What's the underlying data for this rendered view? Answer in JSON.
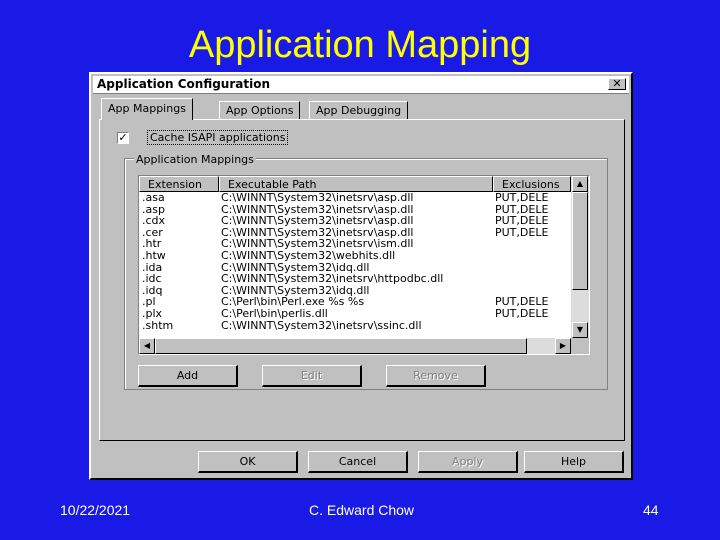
{
  "slide": {
    "title": "Application Mapping",
    "footer_date": "10/22/2021",
    "footer_author": "C. Edward Chow",
    "footer_page": "44"
  },
  "colors": {
    "background": "#1a1ae6",
    "title": "#ffff00",
    "dialog": "#c0c0c0"
  },
  "dialog": {
    "title": "Application Configuration",
    "close_glyph": "✕",
    "tabs": [
      {
        "label": "App Mappings",
        "active": true
      },
      {
        "label": "App Options",
        "active": false
      },
      {
        "label": "App Debugging",
        "active": false
      }
    ],
    "cache_checkbox": {
      "label": "Cache ISAPI applications",
      "checked": true,
      "glyph": "✓"
    },
    "group_label": "Application Mappings",
    "columns": [
      "Extension",
      "Executable Path",
      "Exclusions"
    ],
    "rows": [
      {
        "ext": ".asa",
        "path": "C:\\WINNT\\System32\\inetsrv\\asp.dll",
        "excl": "PUT,DELE"
      },
      {
        "ext": ".asp",
        "path": "C:\\WINNT\\System32\\inetsrv\\asp.dll",
        "excl": "PUT,DELE"
      },
      {
        "ext": ".cdx",
        "path": "C:\\WINNT\\System32\\inetsrv\\asp.dll",
        "excl": "PUT,DELE"
      },
      {
        "ext": ".cer",
        "path": "C:\\WINNT\\System32\\inetsrv\\asp.dll",
        "excl": "PUT,DELE"
      },
      {
        "ext": ".htr",
        "path": "C:\\WINNT\\System32\\inetsrv\\ism.dll",
        "excl": ""
      },
      {
        "ext": ".htw",
        "path": "C:\\WINNT\\System32\\webhits.dll",
        "excl": ""
      },
      {
        "ext": ".ida",
        "path": "C:\\WINNT\\System32\\idq.dll",
        "excl": ""
      },
      {
        "ext": ".idc",
        "path": "C:\\WINNT\\System32\\inetsrv\\httpodbc.dll",
        "excl": ""
      },
      {
        "ext": ".idq",
        "path": "C:\\WINNT\\System32\\idq.dll",
        "excl": ""
      },
      {
        "ext": ".pl",
        "path": "C:\\Perl\\bin\\Perl.exe %s %s",
        "excl": "PUT,DELE"
      },
      {
        "ext": ".plx",
        "path": "C:\\Perl\\bin\\perlis.dll",
        "excl": "PUT,DELE"
      },
      {
        "ext": ".shtm",
        "path": "C:\\WINNT\\System32\\inetsrv\\ssinc.dll",
        "excl": ""
      }
    ],
    "scroll": {
      "up_glyph": "▲",
      "down_glyph": "▼",
      "left_glyph": "◀",
      "right_glyph": "▶"
    },
    "list_buttons": [
      {
        "label": "Add",
        "enabled": true
      },
      {
        "label": "Edit",
        "enabled": false
      },
      {
        "label": "Remove",
        "enabled": false
      }
    ],
    "footer_buttons": [
      {
        "label": "OK",
        "enabled": true
      },
      {
        "label": "Cancel",
        "enabled": true
      },
      {
        "label": "Apply",
        "enabled": false
      },
      {
        "label": "Help",
        "enabled": true
      }
    ]
  }
}
